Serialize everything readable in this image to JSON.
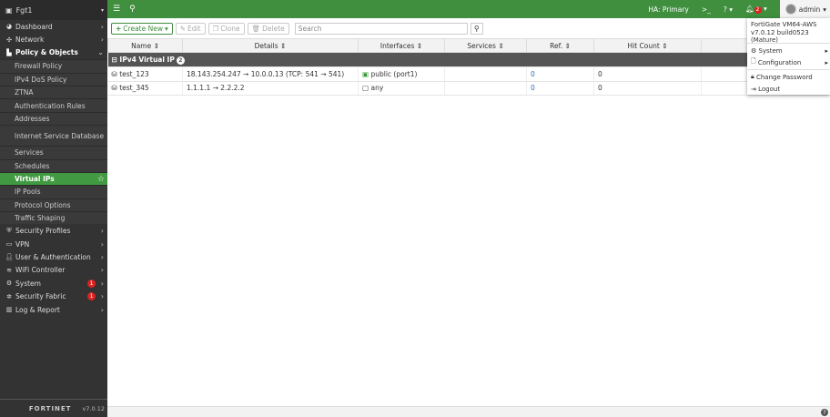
{
  "sidebar": {
    "device": "Fgt1",
    "items": [
      {
        "label": "Dashboard",
        "icon": "dashboard-icon",
        "type": "top"
      },
      {
        "label": "Network",
        "icon": "network-icon",
        "type": "top"
      },
      {
        "label": "Policy & Objects",
        "icon": "policy-icon",
        "type": "open"
      },
      {
        "label": "Firewall Policy",
        "type": "sub"
      },
      {
        "label": "IPv4 DoS Policy",
        "type": "sub"
      },
      {
        "label": "ZTNA",
        "type": "sub"
      },
      {
        "label": "Authentication Rules",
        "type": "sub"
      },
      {
        "label": "Addresses",
        "type": "sub"
      },
      {
        "label": "Internet Service Database",
        "type": "sub2"
      },
      {
        "label": "Services",
        "type": "sub"
      },
      {
        "label": "Schedules",
        "type": "sub"
      },
      {
        "label": "Virtual IPs",
        "type": "active"
      },
      {
        "label": "IP Pools",
        "type": "sub"
      },
      {
        "label": "Protocol Options",
        "type": "sub"
      },
      {
        "label": "Traffic Shaping",
        "type": "sub"
      },
      {
        "label": "Security Profiles",
        "icon": "shield-icon",
        "type": "top"
      },
      {
        "label": "VPN",
        "icon": "vpn-icon",
        "type": "top"
      },
      {
        "label": "User & Authentication",
        "icon": "user-icon",
        "type": "top"
      },
      {
        "label": "WiFi Controller",
        "icon": "wifi-icon",
        "type": "top"
      },
      {
        "label": "System",
        "icon": "gear-icon",
        "type": "top",
        "badge": "1"
      },
      {
        "label": "Security Fabric",
        "icon": "fabric-icon",
        "type": "top",
        "badge": "1"
      },
      {
        "label": "Log & Report",
        "icon": "chart-icon",
        "type": "top"
      }
    ],
    "logo": "FORTINET",
    "version": "v7.0.12"
  },
  "topbar": {
    "ha": "HA: Primary",
    "notifications": "2",
    "user": "admin"
  },
  "toolbar": {
    "create": "Create New",
    "edit": "Edit",
    "clone": "Clone",
    "delete": "Delete",
    "search_placeholder": "Search"
  },
  "table": {
    "columns": [
      "Name",
      "Details",
      "Interfaces",
      "Services",
      "Ref.",
      "Hit Count",
      ""
    ],
    "group": {
      "label": "IPv4 Virtual IP",
      "count": "2"
    },
    "rows": [
      {
        "name": "test_123",
        "details": "18.143.254.247 → 10.0.0.13 (TCP: 541 → 541)",
        "interfaces": "public (port1)",
        "services": "",
        "ref": "0",
        "hits": "0"
      },
      {
        "name": "test_345",
        "details": "1.1.1.1 → 2.2.2.2",
        "interfaces": "any",
        "services": "",
        "ref": "0",
        "hits": "0"
      }
    ]
  },
  "user_menu": {
    "model": "FortiGate VM64-AWS",
    "build": "v7.0.12 build0523 (Mature)",
    "items": [
      "System",
      "Configuration",
      "Change Password",
      "Logout"
    ]
  }
}
